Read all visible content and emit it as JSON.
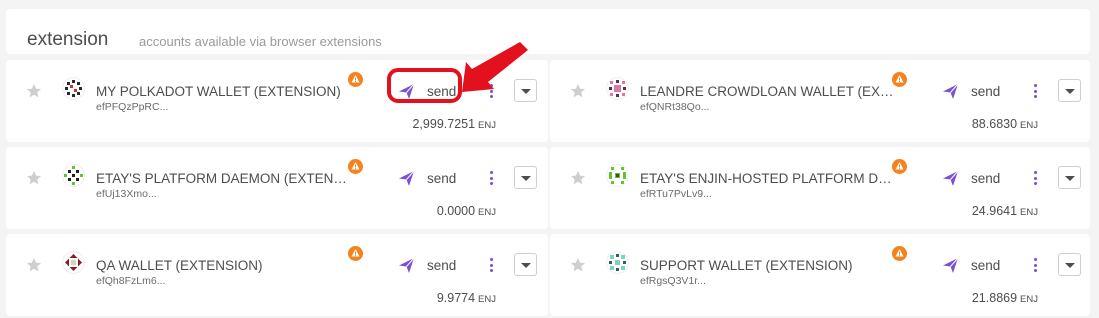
{
  "section": {
    "title": "extension",
    "subtitle": "accounts available via browser extensions"
  },
  "send_label": "send",
  "unit": "ENJ",
  "colors": {
    "accent": "#7b4fd6",
    "warning": "#f5821f",
    "highlight": "#e3101e"
  },
  "accounts": [
    {
      "name": "MY POLKADOT WALLET (EXTENSION)",
      "address": "efPFQzPpRC...",
      "balance": "2,999.7251"
    },
    {
      "name": "LEANDRE CROWDLOAN WALLET (EXTENSION)",
      "address": "efQNRt38Qo...",
      "balance": "88.6830"
    },
    {
      "name": "ETAY'S PLATFORM DAEMON (EXTENSION)",
      "address": "efUj13Xmo...",
      "balance": "0.0000"
    },
    {
      "name": "ETAY'S ENJIN-HOSTED PLATFORM DAEMON (EXTENSION)",
      "address": "efRTu7PvLv9...",
      "balance": "24.9641"
    },
    {
      "name": "QA WALLET (EXTENSION)",
      "address": "efQh8FzLm6...",
      "balance": "9.9774"
    },
    {
      "name": "SUPPORT WALLET (EXTENSION)",
      "address": "efRgsQ3V1r...",
      "balance": "21.8869"
    }
  ]
}
